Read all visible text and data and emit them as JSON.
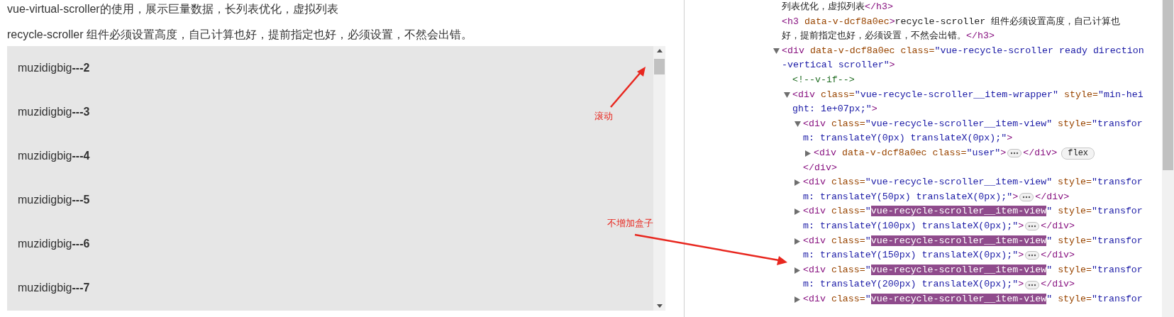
{
  "page": {
    "heading": "vue-virtual-scroller的使用，展示巨量数据，长列表优化，虚拟列表",
    "subheading": "recycle-scroller 组件必须设置高度，自己计算也好，提前指定也好，必须设置，不然会出错。",
    "items": [
      "muzidigbig**---2**",
      "muzidigbig**---3**",
      "muzidigbig**---4**",
      "muzidigbig**---5**",
      "muzidigbig**---6**",
      "muzidigbig**---7**"
    ]
  },
  "annotations": [
    {
      "text": "滚动"
    },
    {
      "text": "不增加盒子"
    }
  ],
  "devtools": {
    "nodes": [
      {
        "lines": [
          [
            {
              "kind": "text",
              "text": "列表优化，虚拟列表"
            },
            {
              "kind": "tag",
              "text": "</h3>"
            }
          ]
        ]
      },
      {
        "lines": [
          [
            {
              "kind": "tag",
              "text": "<h3 "
            },
            {
              "kind": "attr",
              "text": "data-v-dcf8a0ec"
            },
            {
              "kind": "tag",
              "text": ">"
            },
            {
              "kind": "text",
              "text": "recycle-scroller 组件必须设置高度，自己计算也"
            }
          ],
          [
            {
              "kind": "text",
              "text": "好，提前指定也好，必须设置，不然会出错。"
            },
            {
              "kind": "tag",
              "text": "</h3>"
            }
          ]
        ]
      },
      {
        "expanded": true,
        "lines": [
          [
            {
              "kind": "tag",
              "text": "<div "
            },
            {
              "kind": "attr",
              "text": "data-v-dcf8a0ec class="
            },
            {
              "kind": "value",
              "text": "\"vue-recycle-scroller ready direction"
            }
          ],
          [
            {
              "kind": "value",
              "text": "-vertical scroller\""
            },
            {
              "kind": "tag",
              "text": ">"
            }
          ]
        ],
        "children": [
          {
            "lines": [
              [
                {
                  "kind": "comment",
                  "text": "<!--v-if-->"
                }
              ]
            ]
          },
          {
            "expanded": true,
            "lines": [
              [
                {
                  "kind": "tag",
                  "text": "<div "
                },
                {
                  "kind": "attr",
                  "text": "class="
                },
                {
                  "kind": "value",
                  "text": "\"vue-recycle-scroller__item-wrapper\" "
                },
                {
                  "kind": "attr",
                  "text": "style="
                },
                {
                  "kind": "value",
                  "text": "\"min-hei"
                }
              ],
              [
                {
                  "kind": "value",
                  "text": "ght: 1e+07px;\""
                },
                {
                  "kind": "tag",
                  "text": ">"
                }
              ]
            ],
            "children": [
              {
                "expanded": true,
                "lines": [
                  [
                    {
                      "kind": "tag",
                      "text": "<div "
                    },
                    {
                      "kind": "attr",
                      "text": "class="
                    },
                    {
                      "kind": "value",
                      "text": "\"vue-recycle-scroller__item-view\" "
                    },
                    {
                      "kind": "attr",
                      "text": "style="
                    },
                    {
                      "kind": "value",
                      "text": "\"transfor"
                    }
                  ],
                  [
                    {
                      "kind": "value",
                      "text": "m: translateY(0px) translateX(0px);\""
                    },
                    {
                      "kind": "tag",
                      "text": ">"
                    }
                  ]
                ],
                "children": [
                  {
                    "expanded": false,
                    "lines": [
                      [
                        {
                          "kind": "tag",
                          "text": "<div "
                        },
                        {
                          "kind": "attr",
                          "text": "data-v-dcf8a0ec class="
                        },
                        {
                          "kind": "value",
                          "text": "\"user\""
                        },
                        {
                          "kind": "tag",
                          "text": ">"
                        },
                        {
                          "kind": "ellipsis"
                        },
                        {
                          "kind": "tag",
                          "text": "</div>"
                        },
                        {
                          "kind": "badge",
                          "text": "flex"
                        }
                      ]
                    ]
                  }
                ],
                "closing": [
                  {
                    "kind": "tag",
                    "text": "</div>"
                  }
                ]
              },
              {
                "expanded": false,
                "lines": [
                  [
                    {
                      "kind": "tag",
                      "text": "<div "
                    },
                    {
                      "kind": "attr",
                      "text": "class="
                    },
                    {
                      "kind": "value",
                      "text": "\"vue-recycle-scroller__item-view\" "
                    },
                    {
                      "kind": "attr",
                      "text": "style="
                    },
                    {
                      "kind": "value",
                      "text": "\"transfor"
                    }
                  ],
                  [
                    {
                      "kind": "value",
                      "text": "m: translateY(50px) translateX(0px);\""
                    },
                    {
                      "kind": "tag",
                      "text": ">"
                    },
                    {
                      "kind": "ellipsis"
                    },
                    {
                      "kind": "tag",
                      "text": "</div>"
                    }
                  ]
                ]
              },
              {
                "expanded": false,
                "lines": [
                  [
                    {
                      "kind": "tag",
                      "text": "<div "
                    },
                    {
                      "kind": "attr",
                      "text": "class="
                    },
                    {
                      "kind": "value",
                      "text": "\""
                    },
                    {
                      "kind": "match",
                      "text": "vue-recycle-scroller__item-view"
                    },
                    {
                      "kind": "value",
                      "text": "\" "
                    },
                    {
                      "kind": "attr",
                      "text": "style="
                    },
                    {
                      "kind": "value",
                      "text": "\"transfor"
                    }
                  ],
                  [
                    {
                      "kind": "value",
                      "text": "m: translateY(100px) translateX(0px);\""
                    },
                    {
                      "kind": "tag",
                      "text": ">"
                    },
                    {
                      "kind": "ellipsis"
                    },
                    {
                      "kind": "tag",
                      "text": "</div>"
                    }
                  ]
                ]
              },
              {
                "expanded": false,
                "lines": [
                  [
                    {
                      "kind": "tag",
                      "text": "<div "
                    },
                    {
                      "kind": "attr",
                      "text": "class="
                    },
                    {
                      "kind": "value",
                      "text": "\""
                    },
                    {
                      "kind": "match",
                      "text": "vue-recycle-scroller__item-view"
                    },
                    {
                      "kind": "value",
                      "text": "\" "
                    },
                    {
                      "kind": "attr",
                      "text": "style="
                    },
                    {
                      "kind": "value",
                      "text": "\"transfor"
                    }
                  ],
                  [
                    {
                      "kind": "value",
                      "text": "m: translateY(150px) translateX(0px);\""
                    },
                    {
                      "kind": "tag",
                      "text": ">"
                    },
                    {
                      "kind": "ellipsis"
                    },
                    {
                      "kind": "tag",
                      "text": "</div>"
                    }
                  ]
                ]
              },
              {
                "expanded": false,
                "lines": [
                  [
                    {
                      "kind": "tag",
                      "text": "<div "
                    },
                    {
                      "kind": "attr",
                      "text": "class="
                    },
                    {
                      "kind": "value",
                      "text": "\""
                    },
                    {
                      "kind": "match",
                      "text": "vue-recycle-scroller__item-view"
                    },
                    {
                      "kind": "value",
                      "text": "\" "
                    },
                    {
                      "kind": "attr",
                      "text": "style="
                    },
                    {
                      "kind": "value",
                      "text": "\"transfor"
                    }
                  ],
                  [
                    {
                      "kind": "value",
                      "text": "m: translateY(200px) translateX(0px);\""
                    },
                    {
                      "kind": "tag",
                      "text": ">"
                    },
                    {
                      "kind": "ellipsis"
                    },
                    {
                      "kind": "tag",
                      "text": "</div>"
                    }
                  ]
                ]
              },
              {
                "expanded": false,
                "lines": [
                  [
                    {
                      "kind": "tag",
                      "text": "<div "
                    },
                    {
                      "kind": "attr",
                      "text": "class="
                    },
                    {
                      "kind": "value",
                      "text": "\""
                    },
                    {
                      "kind": "match",
                      "text": "vue-recycle-scroller__item-view"
                    },
                    {
                      "kind": "value",
                      "text": "\" "
                    },
                    {
                      "kind": "attr",
                      "text": "style="
                    },
                    {
                      "kind": "value",
                      "text": "\"transfor"
                    }
                  ]
                ]
              }
            ]
          }
        ]
      }
    ]
  }
}
